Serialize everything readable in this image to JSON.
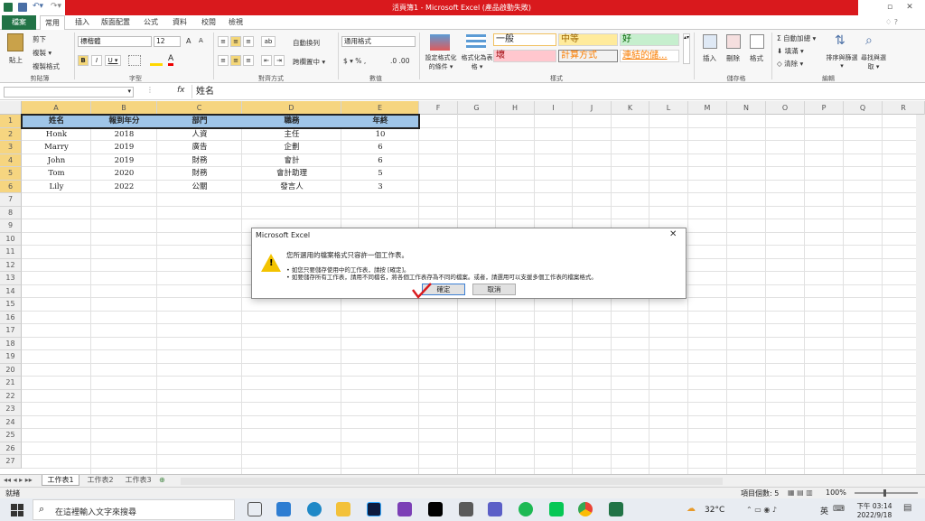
{
  "window": {
    "title": "活頁簿1 - Microsoft Excel (產品啟動失敗)"
  },
  "menu": {
    "file": "檔案",
    "tabs": [
      "常用",
      "插入",
      "版面配置",
      "公式",
      "資料",
      "校閱",
      "檢視"
    ]
  },
  "ribbon": {
    "clipboard": {
      "paste": "貼上",
      "cut": "剪下",
      "copy": "複製 ▾",
      "format_painter": "複製格式",
      "label": "剪貼簿"
    },
    "font": {
      "name": "標楷體",
      "size": "12",
      "grow": "A",
      "shrink": "A",
      "bold": "B",
      "italic": "I",
      "underline": "U ▾",
      "label": "字型"
    },
    "alignment": {
      "wrap": "自動換列",
      "merge": "跨欄置中 ▾",
      "label": "對齊方式"
    },
    "number": {
      "format": "通用格式",
      "label": "數值"
    },
    "styles": {
      "conditional": "設定格式化的條件 ▾",
      "as_table": "格式化為表格 ▾",
      "normal": "一般",
      "medium": "中等",
      "good": "好",
      "bad": "壞",
      "calc": "計算方式",
      "linked": "連結的儲...",
      "label": "樣式"
    },
    "cells": {
      "insert": "插入",
      "delete": "刪除",
      "format": "格式",
      "label": "儲存格"
    },
    "editing": {
      "autosum": "自動加總 ▾",
      "fill": "填滿 ▾",
      "clear": "清除 ▾",
      "sort": "排序與篩選 ▾",
      "find": "尋找與選取 ▾",
      "label": "編輯"
    }
  },
  "formula_bar": {
    "fx": "fx",
    "content": "姓名"
  },
  "columns": [
    "A",
    "B",
    "C",
    "D",
    "E",
    "F",
    "G",
    "H",
    "I",
    "J",
    "K",
    "L",
    "M",
    "N",
    "O",
    "P",
    "Q",
    "R"
  ],
  "rows": [
    "1",
    "2",
    "3",
    "4",
    "5",
    "6",
    "7",
    "8",
    "9",
    "10",
    "11",
    "12",
    "13",
    "14",
    "15",
    "16",
    "17",
    "18",
    "19",
    "20",
    "21",
    "22",
    "23",
    "24",
    "25",
    "26",
    "27"
  ],
  "table": {
    "headers": [
      "姓名",
      "報到年分",
      "部門",
      "職務",
      "年終"
    ],
    "rows": [
      [
        "Honk",
        "2018",
        "人資",
        "主任",
        "10"
      ],
      [
        "Marry",
        "2019",
        "廣告",
        "企劃",
        "6"
      ],
      [
        "John",
        "2019",
        "財務",
        "會計",
        "6"
      ],
      [
        "Tom",
        "2020",
        "財務",
        "會計助理",
        "5"
      ],
      [
        "Lily",
        "2022",
        "公關",
        "發言人",
        "3"
      ]
    ]
  },
  "sheets": [
    "工作表1",
    "工作表2",
    "工作表3"
  ],
  "status": {
    "left": "就緒",
    "count": "項目個數: 5",
    "zoom": "100%"
  },
  "dialog": {
    "title": "Microsoft Excel",
    "message": "您所選用的檔案格式只容許一個工作表。",
    "bullet1": "• 如您只要儲存使用中的工作表，請按 [確定]。",
    "bullet2": "• 如要儲存所有工作表，請用不同檔名，將各個工作表存為不同的檔案。或者，請選用可以支援多個工作表的檔案格式。",
    "ok": "確定",
    "cancel": "取消"
  },
  "taskbar": {
    "search": "在這裡輸入文字來搜尋",
    "weather": "32°C",
    "ime": "英",
    "time": "下午 03:14",
    "date": "2022/9/18"
  },
  "colors": {
    "excel_green": "#217346",
    "title_red": "#d9191d",
    "header_fill": "#9fc5e8"
  }
}
